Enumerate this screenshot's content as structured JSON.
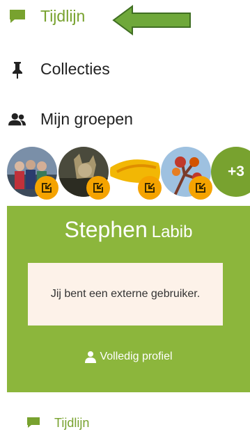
{
  "nav": {
    "items": [
      {
        "label": "Tijdlijn",
        "icon": "comment-icon",
        "active": true
      },
      {
        "label": "Collecties",
        "icon": "pin-icon",
        "active": false
      },
      {
        "label": "Mijn groepen",
        "icon": "users-icon",
        "active": false
      }
    ]
  },
  "groups": {
    "more_label": "+3",
    "badge_icon": "external-link-icon",
    "badge_color": "#f5a300"
  },
  "profile": {
    "first_name": "Stephen",
    "last_name": "Labib",
    "notice": "Jij bent een externe gebruiker.",
    "full_profile_label": "Volledig profiel"
  },
  "bottom_nav": {
    "label": "Tijdlijn",
    "icon": "comment-icon"
  },
  "colors": {
    "accent": "#78a22f",
    "card_bg": "#8cb63c",
    "notice_bg": "#fdf2e9",
    "badge": "#f5a300"
  }
}
